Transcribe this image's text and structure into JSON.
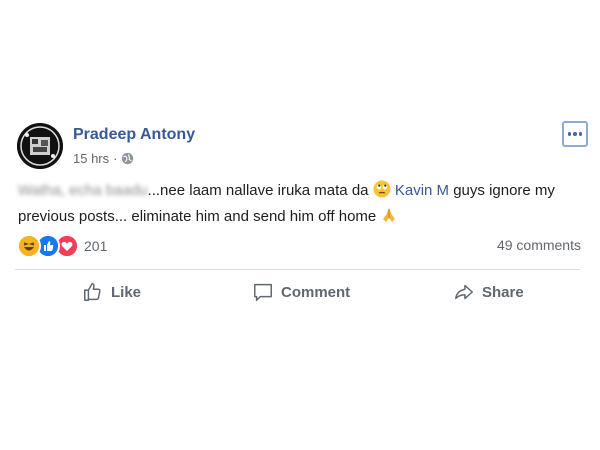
{
  "post": {
    "author": "Pradeep Antony",
    "time": "15 hrs",
    "privacy_icon": "globe-icon",
    "more_icon": "more-options-icon",
    "text": {
      "blurred_prefix": "Watha, echa baadu",
      "part1": "...nee laam nallave iruka mata da",
      "emoji1": "rolling-eyes-emoji",
      "mention": "Kavin M",
      "part2": " guys ignore my previous posts... eliminate him and send him off home",
      "emoji2": "folded-hands-emoji"
    },
    "reactions": {
      "types": [
        "haha",
        "like",
        "love"
      ],
      "count": "201"
    },
    "comments_count": "49 comments",
    "actions": {
      "like": "Like",
      "comment": "Comment",
      "share": "Share"
    }
  },
  "colors": {
    "author": "#385898",
    "muted": "#606770",
    "text": "#1c1e21",
    "like_blue": "#1877f2",
    "love_red": "#f33e58",
    "haha_yellow": "#f7b125"
  }
}
